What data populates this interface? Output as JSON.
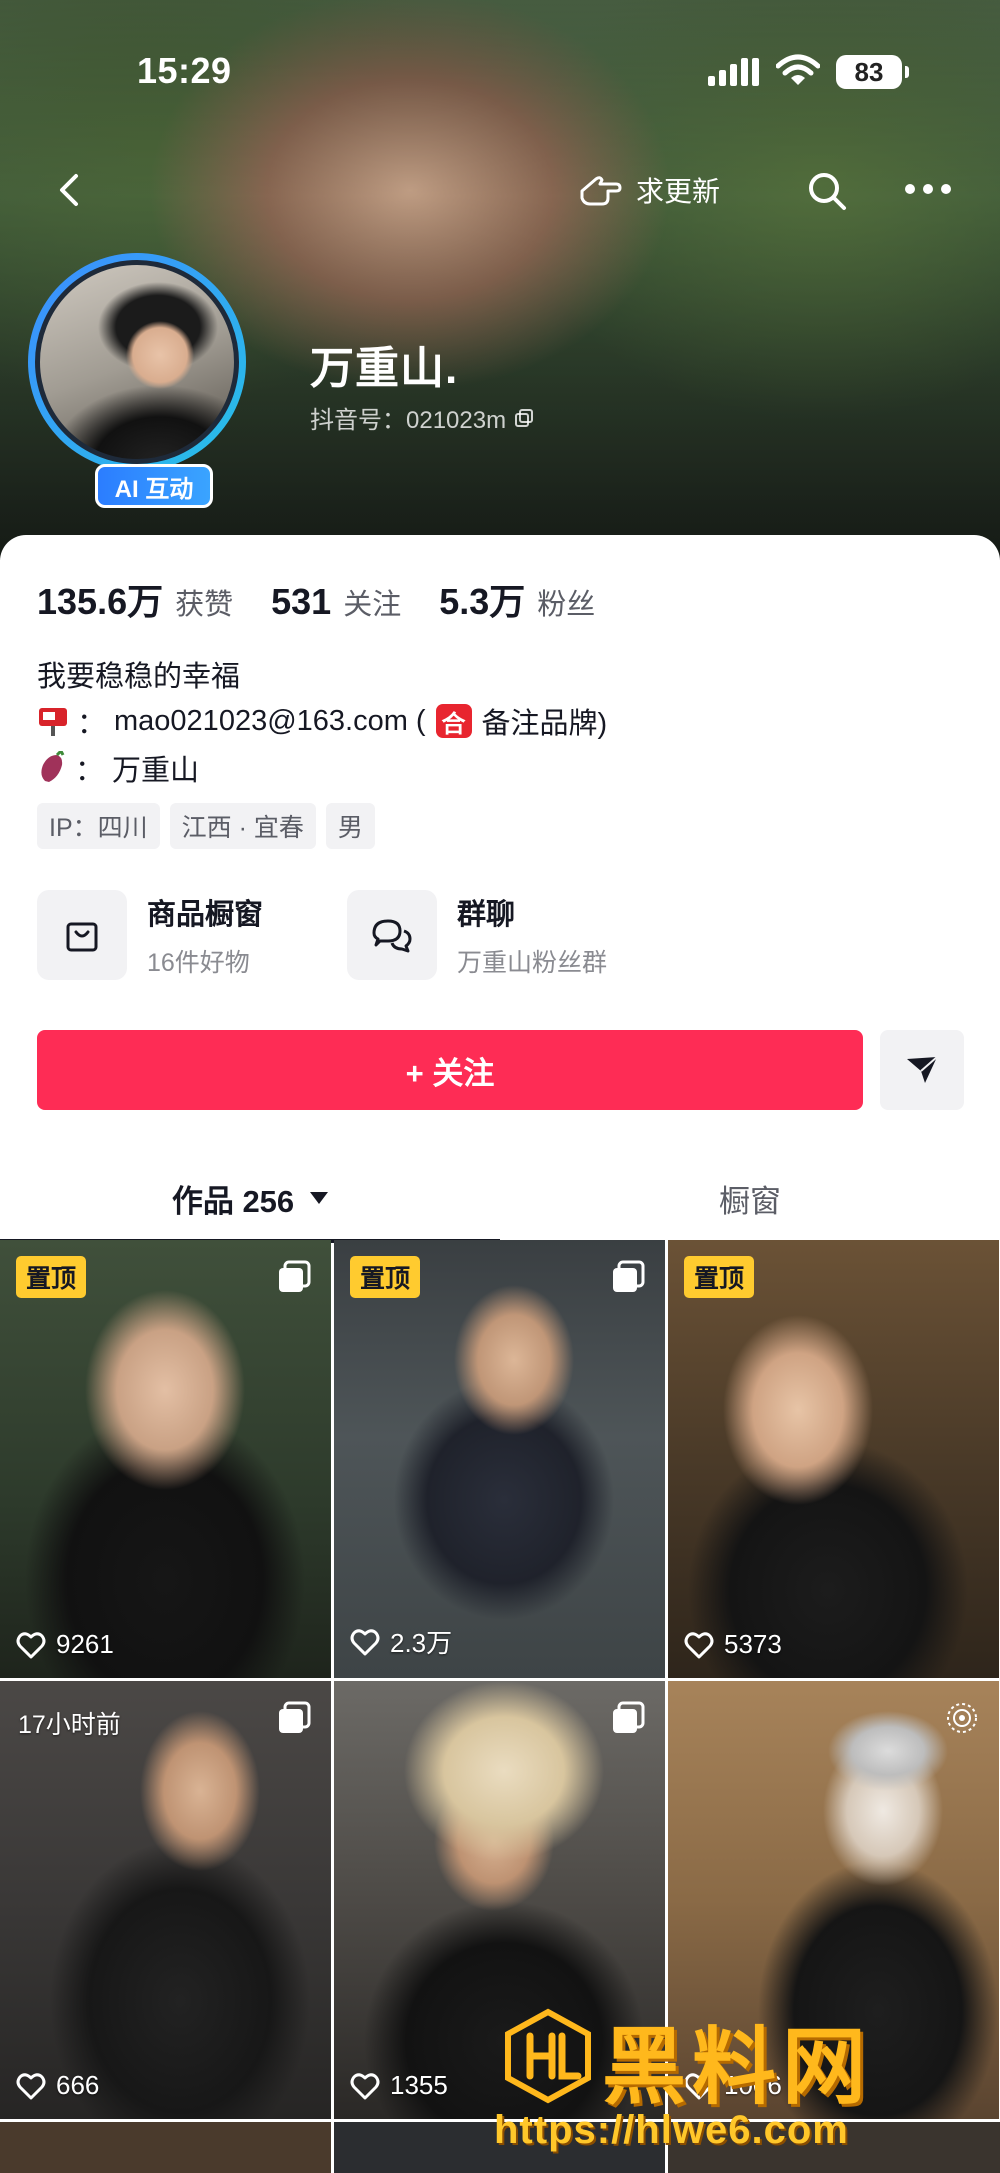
{
  "status_bar": {
    "time": "15:29",
    "battery": "83"
  },
  "nav": {
    "request_update": "求更新"
  },
  "profile": {
    "nickname": "万重山.",
    "douyin_id": "抖音号：021023m",
    "ai_badge": "AI 互动",
    "stats": [
      {
        "num": "135.6万",
        "label": "获赞"
      },
      {
        "num": "531",
        "label": "关注"
      },
      {
        "num": "5.3万",
        "label": "粉丝"
      }
    ],
    "bio": "我要稳稳的幸福",
    "email_line_prefix": "：",
    "email": "mao021023@163.com",
    "email_paren_open": "(",
    "brand_char": "合",
    "brand_note": "备注品牌)",
    "name_line": "：  万重山",
    "tags": [
      "IP：四川",
      "江西 · 宜春",
      "男"
    ],
    "entries": [
      {
        "title": "商品橱窗",
        "sub": "16件好物"
      },
      {
        "title": "群聊",
        "sub": "万重山粉丝群"
      }
    ],
    "follow_label": "+ 关注"
  },
  "tabs": {
    "works": "作品 256",
    "window": "橱窗"
  },
  "grid": [
    {
      "badge": "置顶",
      "likes": "9261",
      "multi": true
    },
    {
      "badge": "置顶",
      "likes": "2.3万",
      "multi": true
    },
    {
      "badge": "置顶",
      "likes": "5373",
      "multi": false
    },
    {
      "time": "17小时前",
      "likes": "666",
      "multi": true
    },
    {
      "likes": "1355",
      "multi": true
    },
    {
      "likes": "1006",
      "multi": false
    }
  ],
  "watermark": {
    "title": "黑料网",
    "url": "https://hlwe6.com"
  },
  "colors": {
    "accent": "#fe2c55",
    "pin": "#ffcb2f",
    "ai_badge": "#2b7dff"
  }
}
